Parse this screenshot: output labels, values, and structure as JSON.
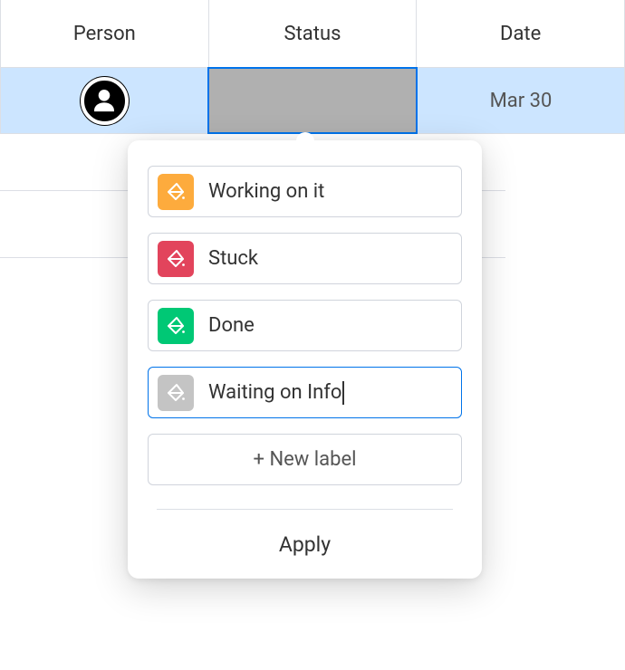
{
  "columns": {
    "person": "Person",
    "status": "Status",
    "date": "Date"
  },
  "row": {
    "date": "Mar 30"
  },
  "popover": {
    "options": [
      {
        "label": "Working on it",
        "color": "orange"
      },
      {
        "label": "Stuck",
        "color": "red"
      },
      {
        "label": "Done",
        "color": "green"
      },
      {
        "label": "Waiting on Info",
        "color": "gray",
        "editing": true
      }
    ],
    "new_label": "+ New label",
    "apply": "Apply"
  }
}
